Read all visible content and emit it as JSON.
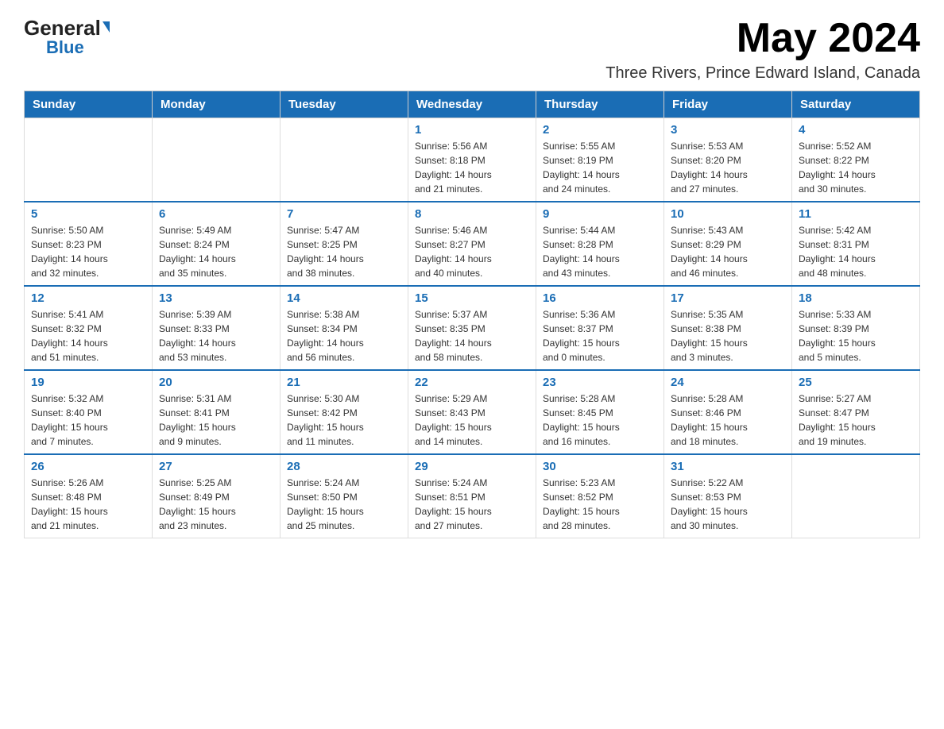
{
  "header": {
    "month_year": "May 2024",
    "location": "Three Rivers, Prince Edward Island, Canada",
    "logo_general": "General",
    "logo_blue": "Blue"
  },
  "days_of_week": [
    "Sunday",
    "Monday",
    "Tuesday",
    "Wednesday",
    "Thursday",
    "Friday",
    "Saturday"
  ],
  "weeks": [
    {
      "days": [
        {
          "num": "",
          "info": ""
        },
        {
          "num": "",
          "info": ""
        },
        {
          "num": "",
          "info": ""
        },
        {
          "num": "1",
          "info": "Sunrise: 5:56 AM\nSunset: 8:18 PM\nDaylight: 14 hours\nand 21 minutes."
        },
        {
          "num": "2",
          "info": "Sunrise: 5:55 AM\nSunset: 8:19 PM\nDaylight: 14 hours\nand 24 minutes."
        },
        {
          "num": "3",
          "info": "Sunrise: 5:53 AM\nSunset: 8:20 PM\nDaylight: 14 hours\nand 27 minutes."
        },
        {
          "num": "4",
          "info": "Sunrise: 5:52 AM\nSunset: 8:22 PM\nDaylight: 14 hours\nand 30 minutes."
        }
      ]
    },
    {
      "days": [
        {
          "num": "5",
          "info": "Sunrise: 5:50 AM\nSunset: 8:23 PM\nDaylight: 14 hours\nand 32 minutes."
        },
        {
          "num": "6",
          "info": "Sunrise: 5:49 AM\nSunset: 8:24 PM\nDaylight: 14 hours\nand 35 minutes."
        },
        {
          "num": "7",
          "info": "Sunrise: 5:47 AM\nSunset: 8:25 PM\nDaylight: 14 hours\nand 38 minutes."
        },
        {
          "num": "8",
          "info": "Sunrise: 5:46 AM\nSunset: 8:27 PM\nDaylight: 14 hours\nand 40 minutes."
        },
        {
          "num": "9",
          "info": "Sunrise: 5:44 AM\nSunset: 8:28 PM\nDaylight: 14 hours\nand 43 minutes."
        },
        {
          "num": "10",
          "info": "Sunrise: 5:43 AM\nSunset: 8:29 PM\nDaylight: 14 hours\nand 46 minutes."
        },
        {
          "num": "11",
          "info": "Sunrise: 5:42 AM\nSunset: 8:31 PM\nDaylight: 14 hours\nand 48 minutes."
        }
      ]
    },
    {
      "days": [
        {
          "num": "12",
          "info": "Sunrise: 5:41 AM\nSunset: 8:32 PM\nDaylight: 14 hours\nand 51 minutes."
        },
        {
          "num": "13",
          "info": "Sunrise: 5:39 AM\nSunset: 8:33 PM\nDaylight: 14 hours\nand 53 minutes."
        },
        {
          "num": "14",
          "info": "Sunrise: 5:38 AM\nSunset: 8:34 PM\nDaylight: 14 hours\nand 56 minutes."
        },
        {
          "num": "15",
          "info": "Sunrise: 5:37 AM\nSunset: 8:35 PM\nDaylight: 14 hours\nand 58 minutes."
        },
        {
          "num": "16",
          "info": "Sunrise: 5:36 AM\nSunset: 8:37 PM\nDaylight: 15 hours\nand 0 minutes."
        },
        {
          "num": "17",
          "info": "Sunrise: 5:35 AM\nSunset: 8:38 PM\nDaylight: 15 hours\nand 3 minutes."
        },
        {
          "num": "18",
          "info": "Sunrise: 5:33 AM\nSunset: 8:39 PM\nDaylight: 15 hours\nand 5 minutes."
        }
      ]
    },
    {
      "days": [
        {
          "num": "19",
          "info": "Sunrise: 5:32 AM\nSunset: 8:40 PM\nDaylight: 15 hours\nand 7 minutes."
        },
        {
          "num": "20",
          "info": "Sunrise: 5:31 AM\nSunset: 8:41 PM\nDaylight: 15 hours\nand 9 minutes."
        },
        {
          "num": "21",
          "info": "Sunrise: 5:30 AM\nSunset: 8:42 PM\nDaylight: 15 hours\nand 11 minutes."
        },
        {
          "num": "22",
          "info": "Sunrise: 5:29 AM\nSunset: 8:43 PM\nDaylight: 15 hours\nand 14 minutes."
        },
        {
          "num": "23",
          "info": "Sunrise: 5:28 AM\nSunset: 8:45 PM\nDaylight: 15 hours\nand 16 minutes."
        },
        {
          "num": "24",
          "info": "Sunrise: 5:28 AM\nSunset: 8:46 PM\nDaylight: 15 hours\nand 18 minutes."
        },
        {
          "num": "25",
          "info": "Sunrise: 5:27 AM\nSunset: 8:47 PM\nDaylight: 15 hours\nand 19 minutes."
        }
      ]
    },
    {
      "days": [
        {
          "num": "26",
          "info": "Sunrise: 5:26 AM\nSunset: 8:48 PM\nDaylight: 15 hours\nand 21 minutes."
        },
        {
          "num": "27",
          "info": "Sunrise: 5:25 AM\nSunset: 8:49 PM\nDaylight: 15 hours\nand 23 minutes."
        },
        {
          "num": "28",
          "info": "Sunrise: 5:24 AM\nSunset: 8:50 PM\nDaylight: 15 hours\nand 25 minutes."
        },
        {
          "num": "29",
          "info": "Sunrise: 5:24 AM\nSunset: 8:51 PM\nDaylight: 15 hours\nand 27 minutes."
        },
        {
          "num": "30",
          "info": "Sunrise: 5:23 AM\nSunset: 8:52 PM\nDaylight: 15 hours\nand 28 minutes."
        },
        {
          "num": "31",
          "info": "Sunrise: 5:22 AM\nSunset: 8:53 PM\nDaylight: 15 hours\nand 30 minutes."
        },
        {
          "num": "",
          "info": ""
        }
      ]
    }
  ]
}
